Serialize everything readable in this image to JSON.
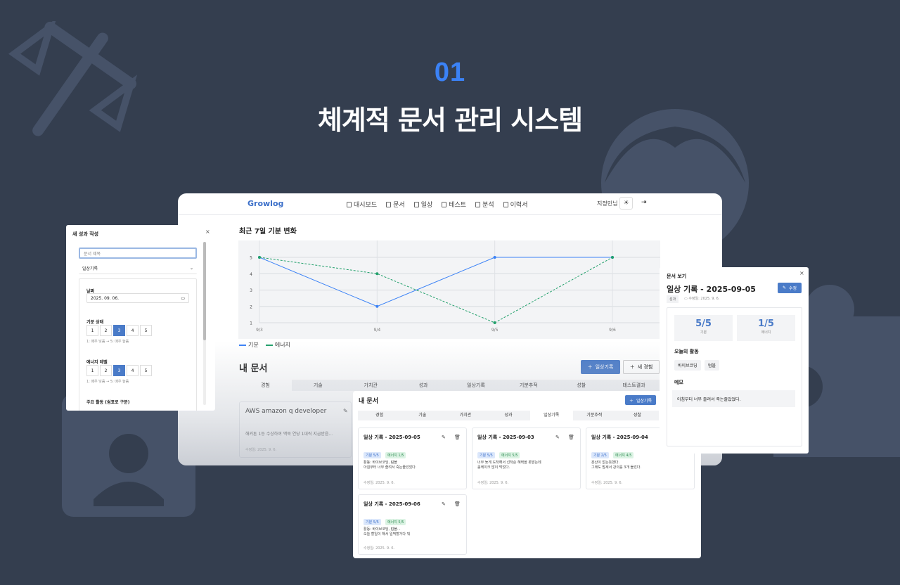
{
  "hero": {
    "number": "01",
    "title": "체계적 문서 관리 시스템"
  },
  "app": {
    "brand": "Growlog",
    "nav": [
      "대시보드",
      "문서",
      "일상",
      "테스트",
      "분석",
      "이력서"
    ],
    "user": "지정민님",
    "theme_icon": "sun-icon",
    "logout_icon": "logout-icon"
  },
  "mood_chart": {
    "title": "최근 7일 기분 변화",
    "legend": [
      "기분",
      "에너지"
    ]
  },
  "chart_data": {
    "type": "line",
    "x": [
      "9/3",
      "9/4",
      "9/5",
      "9/6"
    ],
    "series": [
      {
        "name": "기분",
        "values": [
          5,
          2,
          5,
          5
        ],
        "color": "#3b82f6",
        "style": "solid"
      },
      {
        "name": "에너지",
        "values": [
          5,
          4,
          1,
          5
        ],
        "color": "#22a06b",
        "style": "dashed"
      }
    ],
    "ylim": [
      1,
      5
    ],
    "yticks": [
      1,
      2,
      3,
      4,
      5
    ],
    "grid": true,
    "legend_position": "bottom-left"
  },
  "documents": {
    "title": "내 문서",
    "daily_button": "일상기록",
    "new_button": "새 경험",
    "tabs": [
      "경험",
      "기술",
      "가치관",
      "성과",
      "일상기록",
      "기분추적",
      "성찰",
      "테스트결과"
    ],
    "card_title": "AWS amazon q developer",
    "card_text": "해커톤 1등 수상하여 맥북 연당 1대씩 지급받음...",
    "card_date": "수정일: 2025. 9. 6."
  },
  "new_modal": {
    "title": "새 성과 작성",
    "close": "×",
    "title_placeholder": "문서 제목",
    "category": "일상기록",
    "date_label": "날짜",
    "date_value": "2025. 09. 06.",
    "mood_label": "기분 상태",
    "mood_options": [
      "1",
      "2",
      "3",
      "4",
      "5"
    ],
    "mood_hint": "1: 매우 낮음 → 5: 매우 높음",
    "energy_label": "에너지 레벨",
    "energy_options": [
      "1",
      "2",
      "3",
      "4",
      "5"
    ],
    "energy_hint": "1: 매우 낮음 → 5: 매우 높음",
    "activity_label": "주요 활동 (쉼표로 구분)"
  },
  "front_docs": {
    "title": "내 문서",
    "daily_button": "일상기록",
    "tabs": [
      "경험",
      "기술",
      "가치관",
      "성과",
      "일상기록",
      "기분추적",
      "성찰"
    ],
    "cards": [
      {
        "title": "일상 기록 - 2025-09-05",
        "mood": "기분 5/5",
        "energy": "에너지 1/5",
        "line1": "활동: 바이브코딩, 텀블",
        "line2": "아침부터 너무 졸려서 죽는줄았었다.",
        "date": "수정일: 2025. 9. 6."
      },
      {
        "title": "일상 기록 - 2025-09-03",
        "mood": "기분 5/5",
        "energy": "에너지 5/5",
        "line1": "너무 늦게 도착해서 선착순 혜택을 못받는데",
        "line2": "롤케이크 많이 먹었다.",
        "date": "수정일: 2025. 9. 6."
      },
      {
        "title": "일상 기록 - 2025-09-04",
        "mood": "기분 2/5",
        "energy": "에너지 4/5",
        "line1": "혼산이 없는듯했다.",
        "line2": "그래도 밤새서 강의를 3개 들었다.",
        "date": "수정일: 2025. 9. 6."
      },
      {
        "title": "일상 기록 - 2025-09-06",
        "mood": "기분 5/5",
        "energy": "에너지 5/5",
        "line1": "활동: 바이브코딩, 텀블...",
        "line2": "오늘 할일이 해서 일찍할거다 뭐",
        "date": "수정일: 2025. 9. 6."
      }
    ]
  },
  "view_modal": {
    "title": "문서 보기",
    "close": "×",
    "doc_title": "일상 기록 - 2025-09-05",
    "edit_button": "수정",
    "tag": "성과",
    "modified": "수정일: 2025. 9. 6.",
    "mood_value": "5/5",
    "mood_label": "기분",
    "energy_value": "1/5",
    "energy_label": "에너지",
    "activity_title": "오늘의 활동",
    "activities": [
      "바이브코딩",
      "텀블"
    ],
    "memo_title": "메모",
    "memo": "아침부터 너무 졸려서 죽는줄았었다."
  }
}
